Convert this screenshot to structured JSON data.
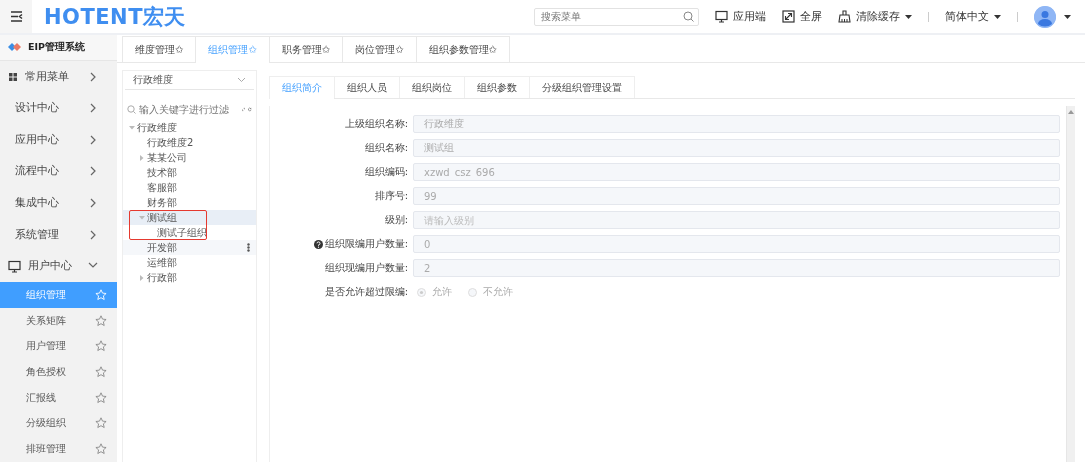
{
  "header": {
    "logo": "HOTENT宏天",
    "search": {
      "placeholder": "搜索菜单"
    },
    "actions": [
      {
        "kind": "monitor",
        "label": "应用端"
      },
      {
        "kind": "fullscreen",
        "label": "全屏"
      },
      {
        "kind": "broom",
        "label": "清除缓存"
      }
    ],
    "language": "简体中文"
  },
  "sidebar": {
    "system": "EIP管理系统",
    "items": [
      {
        "kind": "favorites",
        "label": "常用菜单",
        "expanded": false
      },
      {
        "kind": "module",
        "label": "设计中心",
        "expanded": false
      },
      {
        "kind": "module",
        "label": "应用中心",
        "expanded": false
      },
      {
        "kind": "module",
        "label": "流程中心",
        "expanded": false
      },
      {
        "kind": "module",
        "label": "集成中心",
        "expanded": false
      },
      {
        "kind": "module",
        "label": "系统管理",
        "expanded": false
      },
      {
        "kind": "monitor",
        "label": "用户中心",
        "expanded": true,
        "children": [
          {
            "label": "组织管理",
            "selected": true
          },
          {
            "label": "关系矩阵",
            "selected": false
          },
          {
            "label": "用户管理",
            "selected": false
          },
          {
            "label": "角色授权",
            "selected": false
          },
          {
            "label": "汇报线",
            "selected": false
          },
          {
            "label": "分级组织",
            "selected": false
          },
          {
            "label": "排班管理",
            "selected": false
          }
        ]
      }
    ]
  },
  "tabs": [
    {
      "label": "维度管理✩",
      "selected": false
    },
    {
      "label": "组织管理✩",
      "selected": true
    },
    {
      "label": "职务管理✩",
      "selected": false
    },
    {
      "label": "岗位管理✩",
      "selected": false
    },
    {
      "label": "组织参数管理✩",
      "selected": false
    }
  ],
  "tree": {
    "dimension": "行政维度",
    "filter": {
      "placeholder": "输入关键字进行过滤"
    },
    "nodes": [
      {
        "label": "行政维度",
        "kind": "branch",
        "expanded": true,
        "selected": false,
        "hovered": false,
        "highlighted": false,
        "children": [
          {
            "label": "行政维度2",
            "kind": "leaf",
            "selected": false,
            "hovered": false,
            "highlighted": false
          },
          {
            "label": "某某公司",
            "kind": "branch",
            "expanded": false,
            "selected": false,
            "hovered": false,
            "highlighted": false
          },
          {
            "label": "技术部",
            "kind": "leaf",
            "selected": false,
            "hovered": false,
            "highlighted": false
          },
          {
            "label": "客服部",
            "kind": "leaf",
            "selected": false,
            "hovered": false,
            "highlighted": false
          },
          {
            "label": "财务部",
            "kind": "leaf",
            "selected": false,
            "hovered": false,
            "highlighted": false
          },
          {
            "label": "测试组",
            "kind": "branch",
            "expanded": true,
            "selected": true,
            "hovered": false,
            "highlighted": true,
            "children": [
              {
                "label": "测试子组织",
                "kind": "leaf",
                "selected": false,
                "hovered": false,
                "highlighted": false
              }
            ]
          },
          {
            "label": "开发部",
            "kind": "leaf",
            "selected": false,
            "hovered": true,
            "highlighted": false
          },
          {
            "label": "运维部",
            "kind": "leaf",
            "selected": false,
            "hovered": false,
            "highlighted": false
          },
          {
            "label": "行政部",
            "kind": "branch",
            "expanded": false,
            "selected": false,
            "hovered": false,
            "highlighted": false
          }
        ]
      }
    ]
  },
  "detail": {
    "tabs": [
      {
        "label": "组织简介",
        "selected": true
      },
      {
        "label": "组织人员",
        "selected": false
      },
      {
        "label": "组织岗位",
        "selected": false
      },
      {
        "label": "组织参数",
        "selected": false
      },
      {
        "label": "分级组织管理设置",
        "selected": false
      }
    ],
    "fields": [
      {
        "kind": "text",
        "label": "上级组织名称:",
        "value": "行政维度",
        "disabled": true
      },
      {
        "kind": "text",
        "label": "组织名称:",
        "value": "测试组",
        "disabled": true
      },
      {
        "kind": "text",
        "label": "组织编码:",
        "value": "xzwd_csz_696",
        "disabled": true
      },
      {
        "kind": "text",
        "label": "排序号:",
        "value": "99",
        "disabled": true
      },
      {
        "kind": "text",
        "label": "级别:",
        "placeholder": "请输入级别",
        "disabled": true
      },
      {
        "kind": "help-text",
        "label": "组织限编用户数量:",
        "value": "0",
        "disabled": true
      },
      {
        "kind": "text",
        "label": "组织现编用户数量:",
        "value": "2",
        "disabled": true
      },
      {
        "kind": "radio",
        "label": "是否允许超过限编:",
        "disabled": true,
        "options": [
          {
            "label": "允许",
            "selected": true
          },
          {
            "label": "不允许",
            "selected": false
          }
        ]
      }
    ]
  }
}
